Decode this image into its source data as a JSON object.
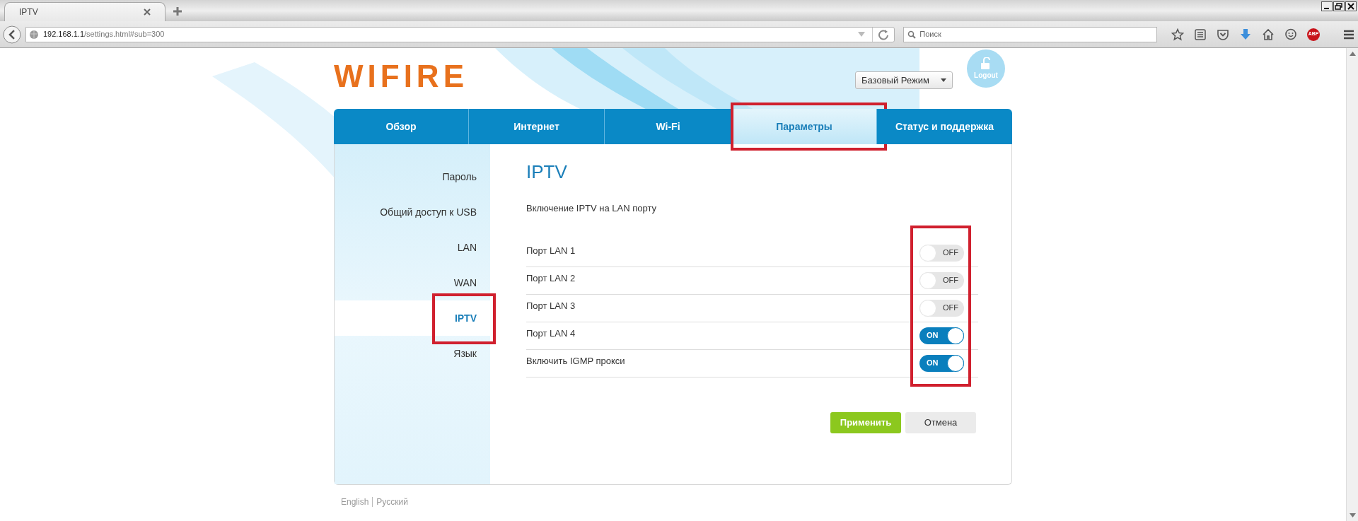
{
  "browser": {
    "tab_title": "IPTV",
    "url_host": "192.168.1.1",
    "url_path": "/settings.html#sub=300",
    "search_placeholder": "Поиск",
    "adblock_label": "ABP"
  },
  "header": {
    "logo": "WIFIRE",
    "mode_select": "Базовый Режим",
    "logout": "Logout"
  },
  "tabs": [
    {
      "label": "Обзор",
      "selected": false,
      "highlighted": false
    },
    {
      "label": "Интернет",
      "selected": false,
      "highlighted": false
    },
    {
      "label": "Wi-Fi",
      "selected": false,
      "highlighted": false
    },
    {
      "label": "Параметры",
      "selected": true,
      "highlighted": true
    },
    {
      "label": "Статус и поддержка",
      "selected": false,
      "highlighted": false
    }
  ],
  "sidebar": {
    "items": [
      {
        "label": "Пароль",
        "selected": false,
        "highlighted": false
      },
      {
        "label": "Общий доступ к USB",
        "selected": false,
        "highlighted": false
      },
      {
        "label": "LAN",
        "selected": false,
        "highlighted": false
      },
      {
        "label": "WAN",
        "selected": false,
        "highlighted": false
      },
      {
        "label": "IPTV",
        "selected": true,
        "highlighted": true
      },
      {
        "label": "Язык",
        "selected": false,
        "highlighted": false
      }
    ]
  },
  "content": {
    "title": "IPTV",
    "subtitle": "Включение IPTV на LAN порту",
    "toggles_highlighted": true,
    "rows": [
      {
        "label": "Порт LAN 1",
        "on": false,
        "toggle_text": "OFF"
      },
      {
        "label": "Порт LAN 2",
        "on": false,
        "toggle_text": "OFF"
      },
      {
        "label": "Порт LAN 3",
        "on": false,
        "toggle_text": "OFF"
      },
      {
        "label": "Порт LAN 4",
        "on": true,
        "toggle_text": "ON"
      },
      {
        "label": "Включить IGMP прокси",
        "on": true,
        "toggle_text": "ON"
      }
    ],
    "buttons": [
      {
        "label": "Применить",
        "kind": "primary"
      },
      {
        "label": "Отмена",
        "kind": "secondary"
      }
    ]
  },
  "footer": {
    "languages": [
      "English",
      "Русский"
    ]
  }
}
